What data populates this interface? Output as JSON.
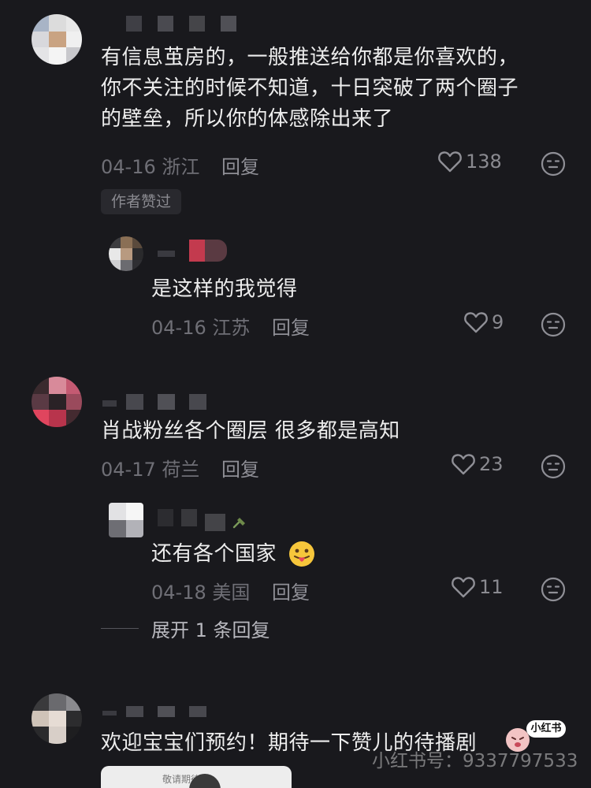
{
  "comments": [
    {
      "text_lines": [
        "有信息茧房的，一般推送给你都是你喜欢的，",
        "你不关注的时候不知道，十日突破了两个圈子",
        "的壁垒，所以你的体感除出来了"
      ],
      "date": "04-16",
      "location": "浙江",
      "reply_label": "回复",
      "likes": "138",
      "author_liked_label": "作者赞过",
      "reply": {
        "text": "是这样的我觉得",
        "date": "04-16",
        "location": "江苏",
        "reply_label": "回复",
        "likes": "9"
      }
    },
    {
      "text": "肖战粉丝各个圈层 很多都是高知",
      "date": "04-17",
      "location": "荷兰",
      "reply_label": "回复",
      "likes": "23",
      "reply": {
        "text": "还有各个国家",
        "date": "04-18",
        "location": "美国",
        "reply_label": "回复",
        "likes": "11"
      },
      "expand_label": "展开 1 条回复"
    },
    {
      "text": "欢迎宝宝们预约！期待一下赞儿的待播剧",
      "card_text": "敬请期待"
    }
  ],
  "watermark": {
    "text": "小红书号：9337797533",
    "badge": "小红书"
  },
  "icons": {
    "like": "heart-icon",
    "face": "emoji-reaction-icon",
    "tongue": "tongue-emoji-icon"
  }
}
